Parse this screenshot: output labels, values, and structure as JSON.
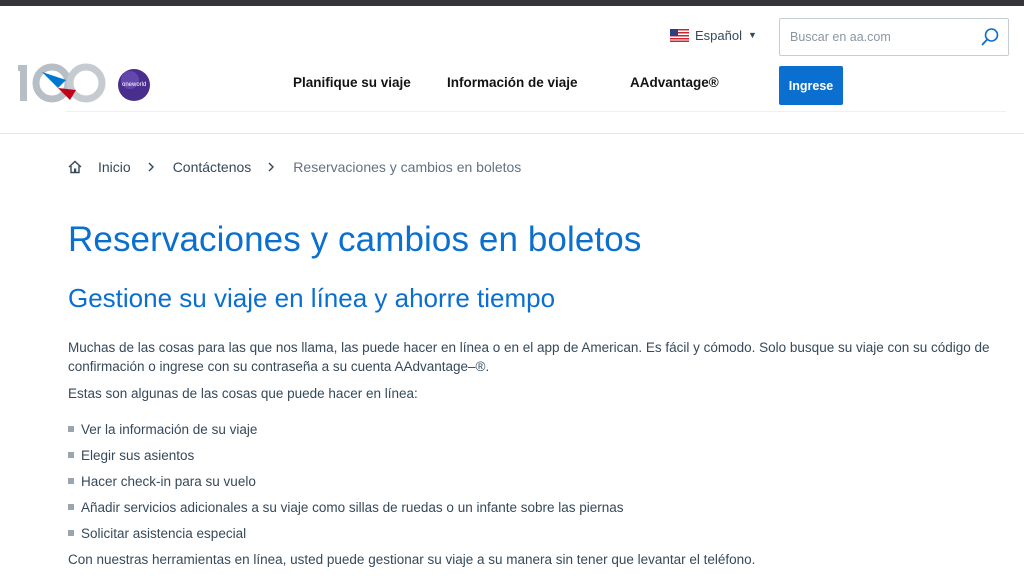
{
  "header": {
    "language": "Español",
    "search_placeholder": "Buscar en aa.com",
    "nav": [
      {
        "label": "Planifique su viaje"
      },
      {
        "label": "Información de viaje"
      },
      {
        "label": "AAdvantage®"
      }
    ],
    "login_label": "Ingrese",
    "oneworld_text": "oneworld",
    "centennial_text": "100"
  },
  "breadcrumb": {
    "items": [
      "Inicio",
      "Contáctenos",
      "Reservaciones y cambios en boletos"
    ]
  },
  "main": {
    "title": "Reservaciones y cambios en boletos",
    "subtitle": "Gestione su viaje en línea y ahorre tiempo",
    "intro": "Muchas de las cosas para las que nos llama, las puede hacer en línea o en el app de American. Es fácil y cómodo. Solo busque su viaje con su código de confirmación o ingrese con su contraseña a su cuenta AAdvantage–®.",
    "lead": "Estas son algunas de las cosas que puede hacer en línea:",
    "items": [
      "Ver la información de su viaje",
      "Elegir sus asientos",
      "Hacer check-in para su vuelo",
      "Añadir servicios adicionales a su viaje como sillas de ruedas o un infante sobre las piernas",
      "Solicitar asistencia especial"
    ],
    "closing": "Con nuestras herramientas en línea, usted puede gestionar su viaje a su manera sin tener que levantar el teléfono."
  },
  "colors": {
    "accent": "#0a6fce",
    "text": "#36495a",
    "topbar": "#36363a"
  },
  "icons": [
    "us-flag-icon",
    "caret-down-icon",
    "search-icon",
    "home-icon",
    "chevron-right-icon",
    "oneworld-logo",
    "centennial-logo"
  ]
}
